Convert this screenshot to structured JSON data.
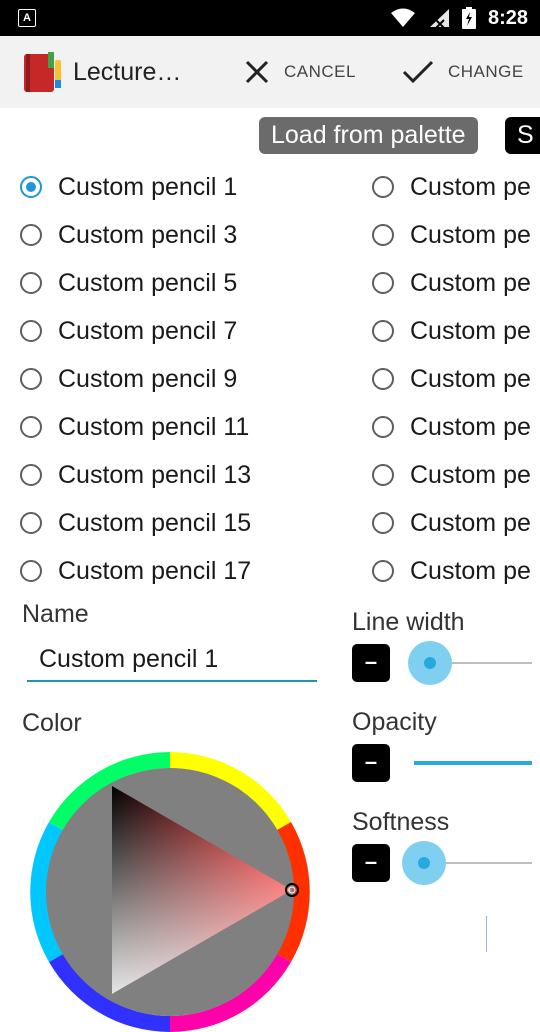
{
  "status_bar": {
    "time": "8:28",
    "left_icon_letter": "A"
  },
  "toolbar": {
    "app_title": "Lecture…",
    "cancel_label": "CANCEL",
    "change_label": "CHANGE"
  },
  "palette": {
    "load_label": "Load from palette",
    "save_label_partial": "S"
  },
  "pencils_left": [
    {
      "label": "Custom pencil 1",
      "checked": true
    },
    {
      "label": "Custom pencil 3",
      "checked": false
    },
    {
      "label": "Custom pencil 5",
      "checked": false
    },
    {
      "label": "Custom pencil 7",
      "checked": false
    },
    {
      "label": "Custom pencil 9",
      "checked": false
    },
    {
      "label": "Custom pencil 11",
      "checked": false
    },
    {
      "label": "Custom pencil 13",
      "checked": false
    },
    {
      "label": "Custom pencil 15",
      "checked": false
    },
    {
      "label": "Custom pencil 17",
      "checked": false
    }
  ],
  "pencils_right": [
    {
      "label": "Custom pe"
    },
    {
      "label": "Custom pe"
    },
    {
      "label": "Custom pe"
    },
    {
      "label": "Custom pe"
    },
    {
      "label": "Custom pe"
    },
    {
      "label": "Custom pe"
    },
    {
      "label": "Custom pe"
    },
    {
      "label": "Custom pe"
    },
    {
      "label": "Custom pe"
    }
  ],
  "name": {
    "label": "Name",
    "value": "Custom pencil 1"
  },
  "color": {
    "label": "Color",
    "selected": "#ff2020"
  },
  "line_width": {
    "label": "Line width",
    "minus": "–",
    "level": 0.05
  },
  "opacity": {
    "label": "Opacity",
    "minus": "–",
    "level": 1.0
  },
  "softness": {
    "label": "Softness",
    "minus": "–",
    "level": 0.0
  },
  "colors": {
    "accent": "#2196d3",
    "toolbar_bg": "#f2f2f2"
  }
}
